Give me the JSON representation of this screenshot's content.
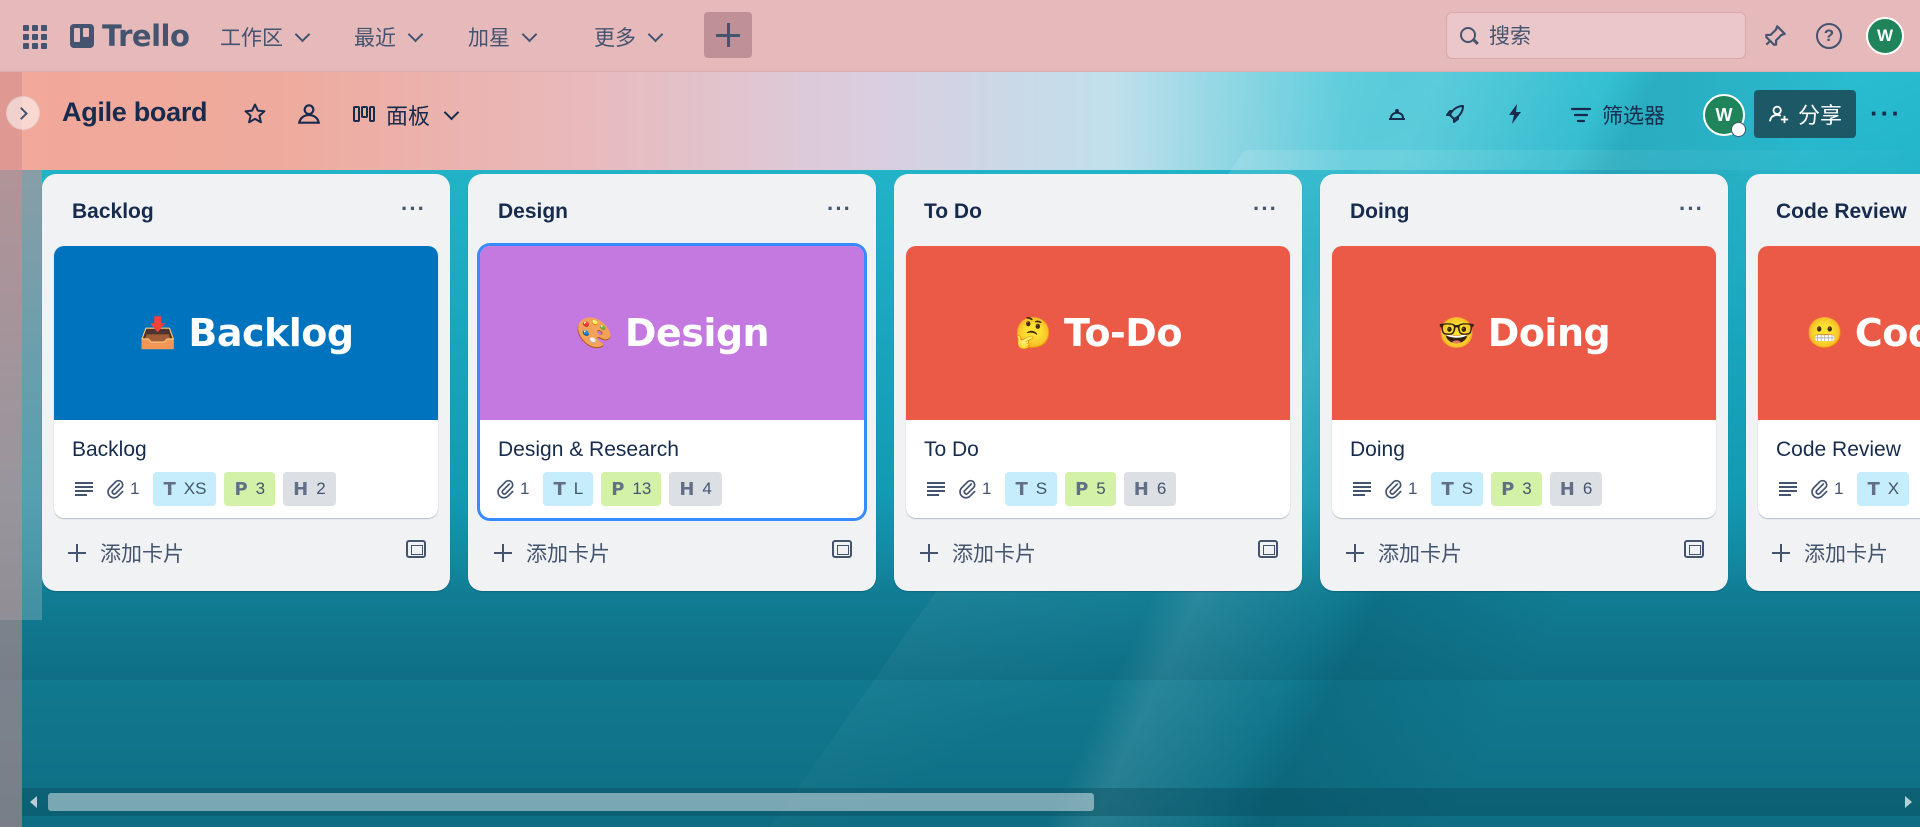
{
  "app": {
    "name": "Trello"
  },
  "topnav": {
    "menus": [
      {
        "label": "工作区"
      },
      {
        "label": "最近"
      },
      {
        "label": "加星"
      },
      {
        "label": "更多"
      }
    ],
    "search_placeholder": "搜索",
    "user_initial": "W"
  },
  "board": {
    "title": "Agile board",
    "view_label": "面板",
    "filter_label": "筛选器",
    "share_label": "分享",
    "member_initial": "W"
  },
  "lists": [
    {
      "title": "Backlog",
      "card": {
        "cover_emoji": "📥",
        "cover_text": "Backlog",
        "cover_color": "#0073bf",
        "name": "Backlog",
        "has_description": true,
        "attachments": "1",
        "tshirt": "XS",
        "points": "3",
        "hours": "2"
      },
      "add_label": "添加卡片"
    },
    {
      "title": "Design",
      "card": {
        "cover_emoji": "🎨",
        "cover_text": "Design",
        "cover_color": "#c379e0",
        "name": "Design & Research",
        "has_description": false,
        "attachments": "1",
        "tshirt": "L",
        "points": "13",
        "hours": "4"
      },
      "add_label": "添加卡片"
    },
    {
      "title": "To Do",
      "card": {
        "cover_emoji": "🤔",
        "cover_text": "To-Do",
        "cover_color": "#eb5a46",
        "name": "To Do",
        "has_description": true,
        "attachments": "1",
        "tshirt": "S",
        "points": "5",
        "hours": "6"
      },
      "add_label": "添加卡片"
    },
    {
      "title": "Doing",
      "card": {
        "cover_emoji": "🤓",
        "cover_text": "Doing",
        "cover_color": "#eb5a46",
        "name": "Doing",
        "has_description": true,
        "attachments": "1",
        "tshirt": "S",
        "points": "3",
        "hours": "6"
      },
      "add_label": "添加卡片"
    },
    {
      "title": "Code Review",
      "card": {
        "cover_emoji": "😬",
        "cover_text": "Cod",
        "cover_color": "#eb5a46",
        "name": "Code Review",
        "has_description": true,
        "attachments": "1",
        "tshirt": "X",
        "points": "",
        "hours": ""
      },
      "add_label": "添加卡片"
    }
  ],
  "colors": {
    "accent": "#388bff",
    "share_bg": "#1c5866",
    "avatar": "#1f845a"
  },
  "icons": [
    "app-switcher-icon",
    "trello-logo-icon",
    "search-icon",
    "notification-icon",
    "help-icon",
    "star-icon",
    "visibility-icon",
    "board-view-icon",
    "power-up-icon",
    "rocket-icon",
    "lightning-icon",
    "filter-icon",
    "add-member-icon",
    "more-icon",
    "description-icon",
    "attachment-icon",
    "tshirt-size-icon",
    "story-points-icon",
    "hours-icon",
    "plus-icon",
    "card-template-icon"
  ]
}
